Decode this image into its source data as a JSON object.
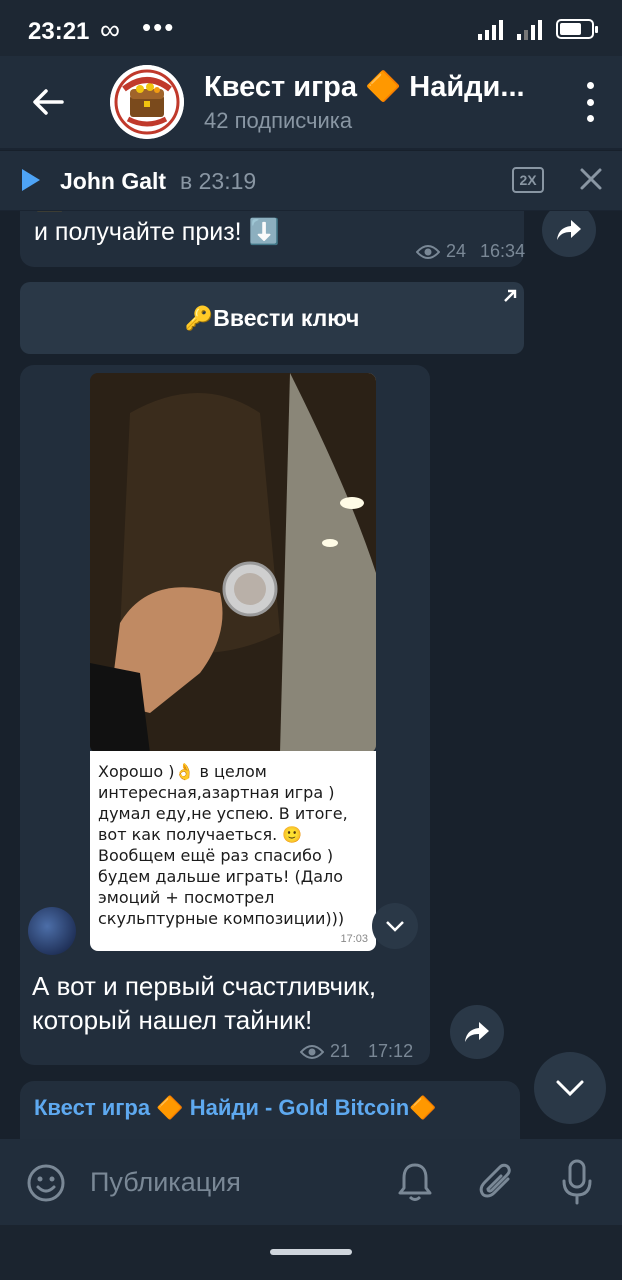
{
  "status": {
    "time": "23:21",
    "infinity": "∞",
    "dots": "•••"
  },
  "header": {
    "title": "Квест игра 🔶 Найди...",
    "subtitle": "42 подписчика"
  },
  "player": {
    "name": "John Galt",
    "time": "в 23:19",
    "speed": "2X"
  },
  "messages": {
    "m1": {
      "text": "🟨Нашли тайник! Скорее вводите ключ и получайте приз! ⬇️",
      "views": "24",
      "time": "16:34"
    },
    "key_button": "🔑Ввести ключ",
    "m2": {
      "caption": "Хорошо )👌 в целом интересная,азартная игра ) думал еду,не успею. В итоге, вот как получаеться. 🙂 Вообщем ещё раз спасибо ) будем дальше играть! (Дало эмоций + посмотрел скульптурные композиции)))",
      "caption_time": "17:03",
      "text": "А вот и первый счастливчик, который нашел тайник!",
      "views": "21",
      "time": "17:12"
    },
    "m3": {
      "title": "Квест игра 🔶 Найди - Gold Bitcoin🔶"
    }
  },
  "input": {
    "placeholder": "Публикация"
  },
  "colors": {
    "accent": "#4ea4f6",
    "bubble": "#222e3c",
    "background": "#18212c"
  }
}
